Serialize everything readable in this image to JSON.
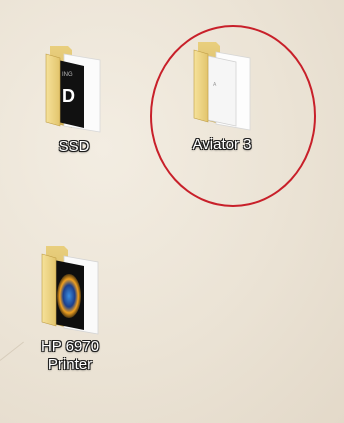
{
  "desktop": {
    "background_color": "#ede5d7",
    "icons": [
      {
        "label": "SSD",
        "icon": "folder-with-black-document-icon"
      },
      {
        "label": "Aviator 3",
        "icon": "folder-with-blank-documents-icon"
      },
      {
        "label": "HP 6970\nPrinter",
        "icon": "folder-with-printer-image-icon"
      }
    ]
  },
  "annotation": {
    "highlight_color": "#c8202a",
    "target": "Aviator 3"
  }
}
